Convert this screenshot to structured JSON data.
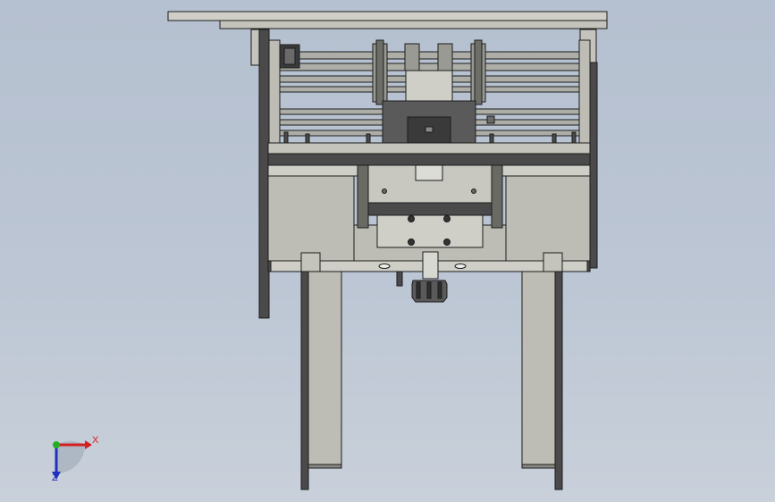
{
  "axes": {
    "x_label": "X",
    "z_label": "Z",
    "colors": {
      "x": "#d42020",
      "y": "#22b022",
      "z": "#2030c0"
    }
  },
  "colors": {
    "background_top": "#b5c0d0",
    "background_bottom": "#c9d0da",
    "part_fill": "#b8b8b0",
    "part_fill_light": "#cfcfc8",
    "part_dark": "#3c3c3c",
    "edge": "#1c1c1c"
  }
}
